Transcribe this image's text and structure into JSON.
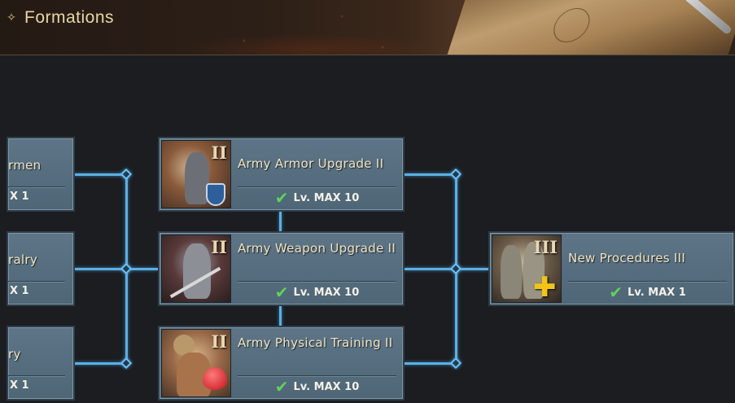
{
  "header": {
    "title": "Formations",
    "title_icon": "compass-ornament-icon"
  },
  "left_column": [
    {
      "name": "rmen",
      "level": "X 1"
    },
    {
      "name": "ralry",
      "level": "X 1"
    },
    {
      "name": "ry",
      "level": "X 1"
    }
  ],
  "middle_column": [
    {
      "name": "Army Armor Upgrade II",
      "roman": "II",
      "level": "Lv. MAX 10",
      "icon": "armored-knight-icon"
    },
    {
      "name": "Army Weapon Upgrade II",
      "roman": "II",
      "level": "Lv. MAX 10",
      "icon": "sword-knight-icon"
    },
    {
      "name": "Army Physical Training II",
      "roman": "II",
      "level": "Lv. MAX 10",
      "icon": "strongman-heart-icon"
    }
  ],
  "right_column": [
    {
      "name": "New Procedures III",
      "roman": "III",
      "level": "Lv. MAX 1",
      "icon": "knights-plus-icon"
    }
  ],
  "colors": {
    "connector": "#5ab0e6",
    "card_bg": "#5d7586",
    "check": "#5fd35a",
    "title": "#e9d6a3"
  }
}
